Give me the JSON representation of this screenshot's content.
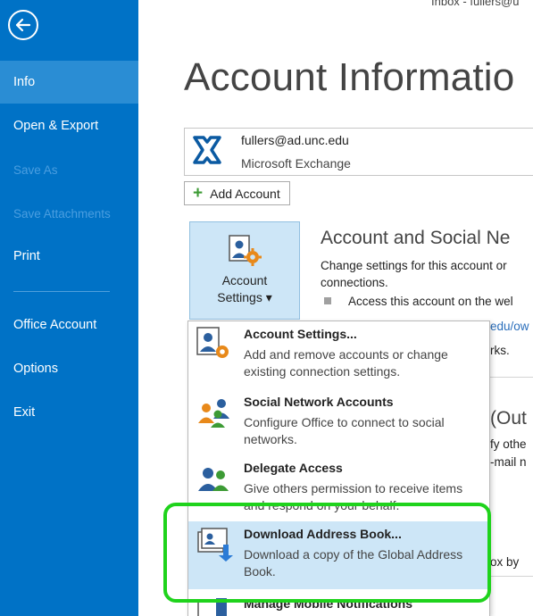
{
  "breadcrumb": "Inbox - fullers@u",
  "nav": {
    "items": [
      {
        "label": "Info"
      },
      {
        "label": "Open & Export"
      },
      {
        "label": "Save As"
      },
      {
        "label": "Save Attachments"
      },
      {
        "label": "Print"
      },
      {
        "label": "Office Account"
      },
      {
        "label": "Options"
      },
      {
        "label": "Exit"
      }
    ],
    "active_index": 0
  },
  "page_title": "Account Informatio",
  "account": {
    "email": "fullers@ad.unc.edu",
    "type": "Microsoft Exchange"
  },
  "add_account_label": "Add Account",
  "account_settings_button": {
    "line1": "Account",
    "line2": "Settings ▾"
  },
  "section": {
    "title": "Account and Social Ne",
    "desc_line1": "Change settings for this account or",
    "desc_line2": "connections.",
    "bullet": "Access this account on the wel",
    "link_partial": "edu/ow",
    "rks_partial": "rks.",
    "out_partial": "(Out",
    "fy_partial": "fy othe",
    "mail_partial": "-mail n",
    "ox_partial": "ox by"
  },
  "menu": {
    "items": [
      {
        "title": "Account Settings...",
        "desc": "Add and remove accounts or change existing connection settings."
      },
      {
        "title": "Social Network Accounts",
        "desc": "Configure Office to connect to social networks."
      },
      {
        "title": "Delegate Access",
        "desc": "Give others permission to receive items and respond on your behalf."
      },
      {
        "title": "Download Address Book...",
        "desc": "Download a copy of the Global Address Book."
      },
      {
        "title": "Manage Mobile Notifications",
        "desc": ""
      }
    ],
    "hover_index": 3
  },
  "colors": {
    "nav_bg": "#0072c6",
    "nav_active": "#2a8dd4",
    "menu_hover": "#cde6f7",
    "highlight": "#1fd31c"
  }
}
